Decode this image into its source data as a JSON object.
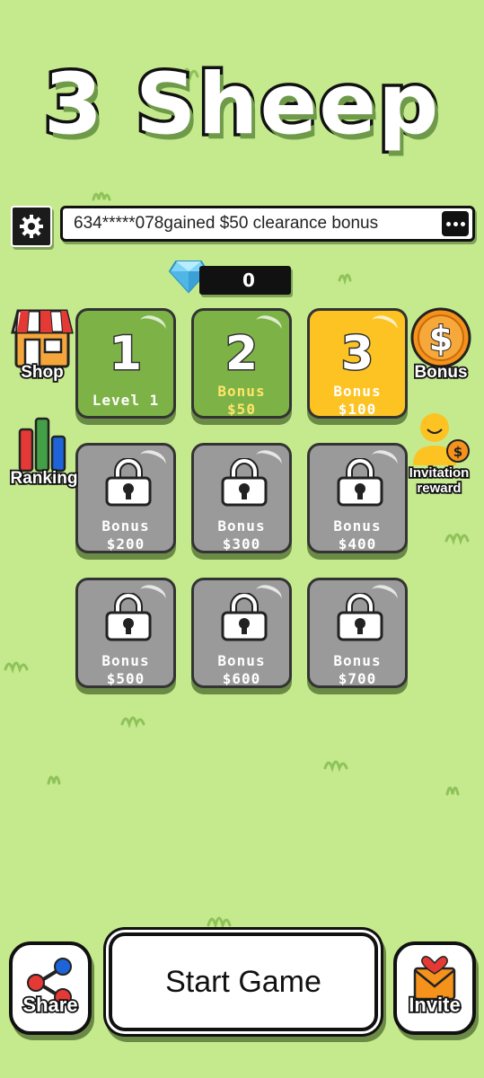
{
  "title": "3 Sheep",
  "ticker": {
    "text": "634*****078gained $50 clearance bonus"
  },
  "gems": {
    "count": "0"
  },
  "levels": [
    {
      "number": "1",
      "line1": "Level 1",
      "line2": "",
      "state": "unlocked"
    },
    {
      "number": "2",
      "line1": "Bonus",
      "line2": "$50",
      "state": "unlocked"
    },
    {
      "number": "3",
      "line1": "Bonus",
      "line2": "$100",
      "state": "current"
    },
    {
      "number": "",
      "line1": "Bonus",
      "line2": "$200",
      "state": "locked"
    },
    {
      "number": "",
      "line1": "Bonus",
      "line2": "$300",
      "state": "locked"
    },
    {
      "number": "",
      "line1": "Bonus",
      "line2": "$400",
      "state": "locked"
    },
    {
      "number": "",
      "line1": "Bonus",
      "line2": "$500",
      "state": "locked"
    },
    {
      "number": "",
      "line1": "Bonus",
      "line2": "$600",
      "state": "locked"
    },
    {
      "number": "",
      "line1": "Bonus",
      "line2": "$700",
      "state": "locked"
    }
  ],
  "side": {
    "shop": "Shop",
    "ranking": "Ranking",
    "bonus": "Bonus",
    "invitation_line1": "Invitation",
    "invitation_line2": "reward"
  },
  "bottom": {
    "share": "Share",
    "start": "Start Game",
    "invite": "Invite"
  },
  "colors": {
    "background": "#c5ea8e",
    "tile_green": "#7db346",
    "tile_yellow": "#fcc322",
    "tile_locked": "#9a9a9a"
  }
}
